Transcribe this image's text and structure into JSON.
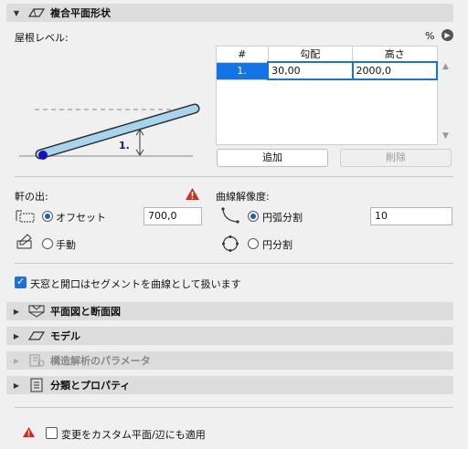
{
  "header": {
    "title": "複合平面形状"
  },
  "roof_level": {
    "label": "屋根レベル:",
    "unit": "%"
  },
  "table": {
    "columns": [
      "#",
      "勾配",
      "高さ"
    ],
    "rows": [
      {
        "num": "1.",
        "slope": "30,00",
        "height": "2000,0"
      }
    ]
  },
  "diagram": {
    "label": "1."
  },
  "buttons": {
    "add": "追加",
    "delete": "削除"
  },
  "eave": {
    "label": "軒の出:",
    "offset_label": "オフセット",
    "offset_value": "700,0",
    "manual_label": "手動"
  },
  "curve": {
    "label": "曲線解像度:",
    "arc_label": "円弧分割",
    "arc_value": "10",
    "circle_label": "円分割"
  },
  "skylight_checkbox": {
    "label": "天窓と開口はセグメントを曲線として扱います"
  },
  "sections": [
    {
      "label": "平面図と断面図"
    },
    {
      "label": "モデル"
    },
    {
      "label": "構造解析のパラメータ"
    },
    {
      "label": "分類とプロパティ"
    }
  ],
  "footer": {
    "apply_label": "変更をカスタム平面/辺にも適用"
  }
}
